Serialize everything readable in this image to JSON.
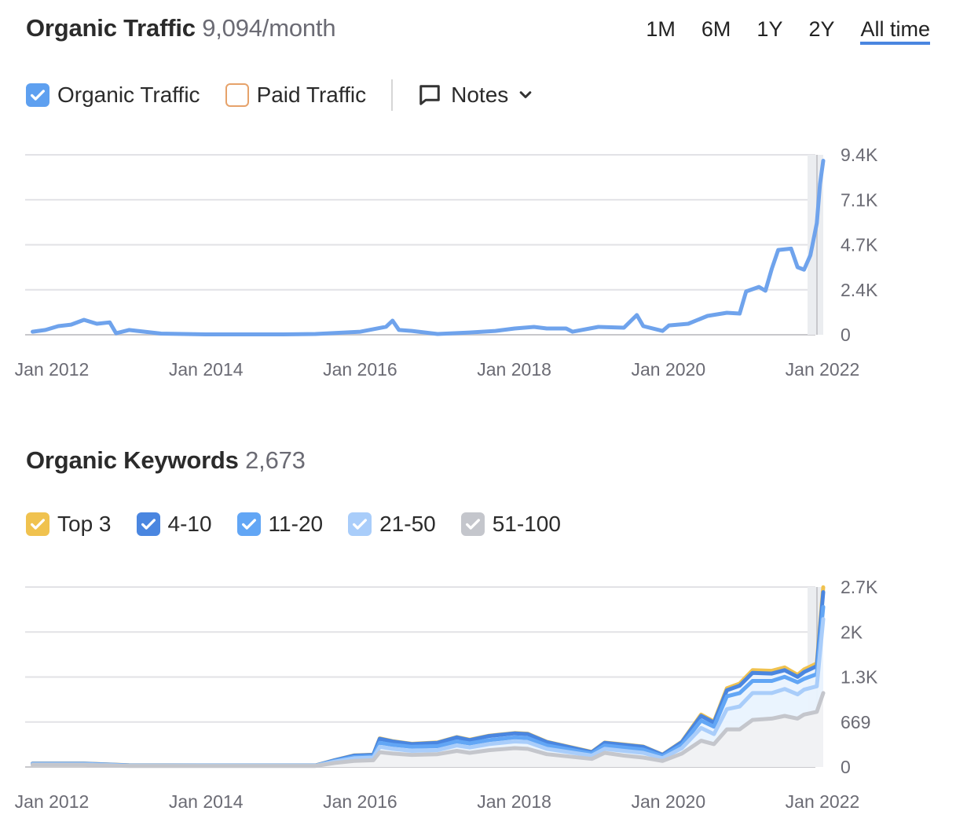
{
  "traffic": {
    "title": "Organic Traffic",
    "value": "9,094/month",
    "periods": [
      {
        "label": "1M",
        "active": false
      },
      {
        "label": "6M",
        "active": false
      },
      {
        "label": "1Y",
        "active": false
      },
      {
        "label": "2Y",
        "active": false
      },
      {
        "label": "All time",
        "active": true
      }
    ],
    "legend": {
      "organic": {
        "label": "Organic Traffic",
        "checked": true,
        "color": "#5ea0f0"
      },
      "paid": {
        "label": "Paid Traffic",
        "checked": false,
        "color": "#e6a26a"
      },
      "notes": {
        "label": "Notes"
      }
    }
  },
  "keywords": {
    "title": "Organic Keywords",
    "value": "2,673",
    "legend": [
      {
        "label": "Top 3",
        "checked": true,
        "color": "#f0c24f"
      },
      {
        "label": "4-10",
        "checked": true,
        "color": "#4a86e0"
      },
      {
        "label": "11-20",
        "checked": true,
        "color": "#62a6f5"
      },
      {
        "label": "21-50",
        "checked": true,
        "color": "#a9cdfa"
      },
      {
        "label": "51-100",
        "checked": true,
        "color": "#c4c6cc"
      }
    ]
  },
  "chart_data": [
    {
      "type": "line",
      "title": "Organic Traffic",
      "xlabel": "",
      "ylabel": "",
      "x_ticks": [
        "Jan 2012",
        "Jan 2014",
        "Jan 2016",
        "Jan 2018",
        "Jan 2020",
        "Jan 2022"
      ],
      "y_ticks": [
        "0",
        "2.4K",
        "4.7K",
        "7.1K",
        "9.4K"
      ],
      "ylim": [
        0,
        9400
      ],
      "xlim": [
        "2011-10",
        "2022-01"
      ],
      "grid": true,
      "legend": "top-left",
      "series": [
        {
          "name": "Organic Traffic",
          "color": "#6fa3ec",
          "x": [
            "2011-10",
            "2011-12",
            "2012-02",
            "2012-04",
            "2012-06",
            "2012-08",
            "2012-10",
            "2012-11",
            "2013-01",
            "2013-06",
            "2014-01",
            "2015-01",
            "2015-06",
            "2016-01",
            "2016-05",
            "2016-06",
            "2016-07",
            "2016-09",
            "2017-01",
            "2017-06",
            "2017-10",
            "2018-01",
            "2018-04",
            "2018-06",
            "2018-09",
            "2018-10",
            "2019-02",
            "2019-06",
            "2019-08",
            "2019-09",
            "2019-12",
            "2020-01",
            "2020-04",
            "2020-07",
            "2020-10",
            "2020-12",
            "2021-01",
            "2021-03",
            "2021-04",
            "2021-05",
            "2021-06",
            "2021-08",
            "2021-09",
            "2021-10",
            "2021-11",
            "2021-12",
            "2021-12.5",
            "2022-01"
          ],
          "values": [
            160,
            250,
            450,
            530,
            780,
            575,
            650,
            80,
            250,
            60,
            20,
            20,
            40,
            160,
            420,
            740,
            250,
            200,
            40,
            120,
            200,
            330,
            410,
            330,
            330,
            160,
            410,
            370,
            1030,
            450,
            200,
            490,
            575,
            985,
            1150,
            1110,
            2260,
            2500,
            2300,
            3450,
            4430,
            4500,
            3530,
            3400,
            4150,
            5830,
            7880,
            9094
          ]
        }
      ]
    },
    {
      "type": "area",
      "title": "Organic Keywords",
      "xlabel": "",
      "ylabel": "",
      "x_ticks": [
        "Jan 2012",
        "Jan 2014",
        "Jan 2016",
        "Jan 2018",
        "Jan 2020",
        "Jan 2022"
      ],
      "y_ticks": [
        "0",
        "669",
        "1.3K",
        "2K",
        "2.7K"
      ],
      "ylim": [
        0,
        2676
      ],
      "xlim": [
        "2011-10",
        "2022-01"
      ],
      "grid": true,
      "legend": "top-left",
      "stacked": true,
      "x": [
        "2011-10",
        "2012-06",
        "2013-01",
        "2014-01",
        "2015-06",
        "2015-09",
        "2015-12",
        "2016-03",
        "2016-04",
        "2016-06",
        "2016-09",
        "2017-01",
        "2017-04",
        "2017-06",
        "2017-09",
        "2018-01",
        "2018-03",
        "2018-06",
        "2019-01",
        "2019-03",
        "2019-06",
        "2019-09",
        "2019-12",
        "2020-03",
        "2020-06",
        "2020-08",
        "2020-10",
        "2020-12",
        "2021-02",
        "2021-05",
        "2021-07",
        "2021-09",
        "2021-10",
        "2021-12",
        "2022-01"
      ],
      "series": [
        {
          "name": "51-100 (cumulative)",
          "color": "#c4c6cc",
          "values": [
            30,
            30,
            15,
            15,
            15,
            60,
            90,
            100,
            220,
            200,
            180,
            190,
            240,
            210,
            250,
            280,
            270,
            190,
            120,
            210,
            170,
            140,
            90,
            200,
            390,
            340,
            560,
            560,
            700,
            720,
            760,
            720,
            780,
            820,
            1100
          ]
        },
        {
          "name": "21-50 (cumulative)",
          "color": "#a9cdfa",
          "values": [
            40,
            40,
            20,
            18,
            18,
            80,
            130,
            140,
            300,
            270,
            240,
            250,
            320,
            290,
            340,
            380,
            370,
            270,
            170,
            270,
            240,
            210,
            130,
            280,
            580,
            490,
            860,
            900,
            1100,
            1100,
            1160,
            1080,
            1150,
            1200,
            2200
          ]
        },
        {
          "name": "11-20 (cumulative)",
          "color": "#62a6f5",
          "values": [
            45,
            45,
            22,
            20,
            20,
            90,
            150,
            160,
            360,
            330,
            300,
            310,
            380,
            350,
            400,
            440,
            430,
            320,
            200,
            320,
            290,
            260,
            160,
            330,
            690,
            600,
            1050,
            1100,
            1280,
            1280,
            1340,
            1260,
            1310,
            1380,
            2380
          ]
        },
        {
          "name": "4-10 (cumulative)",
          "color": "#4a86e0",
          "values": [
            50,
            50,
            25,
            22,
            22,
            100,
            170,
            180,
            420,
            380,
            340,
            360,
            440,
            400,
            460,
            500,
            490,
            370,
            220,
            360,
            330,
            300,
            180,
            370,
            760,
            660,
            1140,
            1210,
            1400,
            1390,
            1440,
            1340,
            1410,
            1500,
            2600
          ]
        },
        {
          "name": "Top 3 (cumulative)",
          "color": "#f0c24f",
          "values": [
            52,
            52,
            26,
            23,
            23,
            102,
            172,
            182,
            425,
            385,
            345,
            365,
            445,
            405,
            465,
            505,
            495,
            375,
            224,
            364,
            334,
            304,
            184,
            376,
            780,
            675,
            1170,
            1240,
            1440,
            1430,
            1480,
            1370,
            1450,
            1540,
            2673
          ]
        }
      ]
    }
  ]
}
